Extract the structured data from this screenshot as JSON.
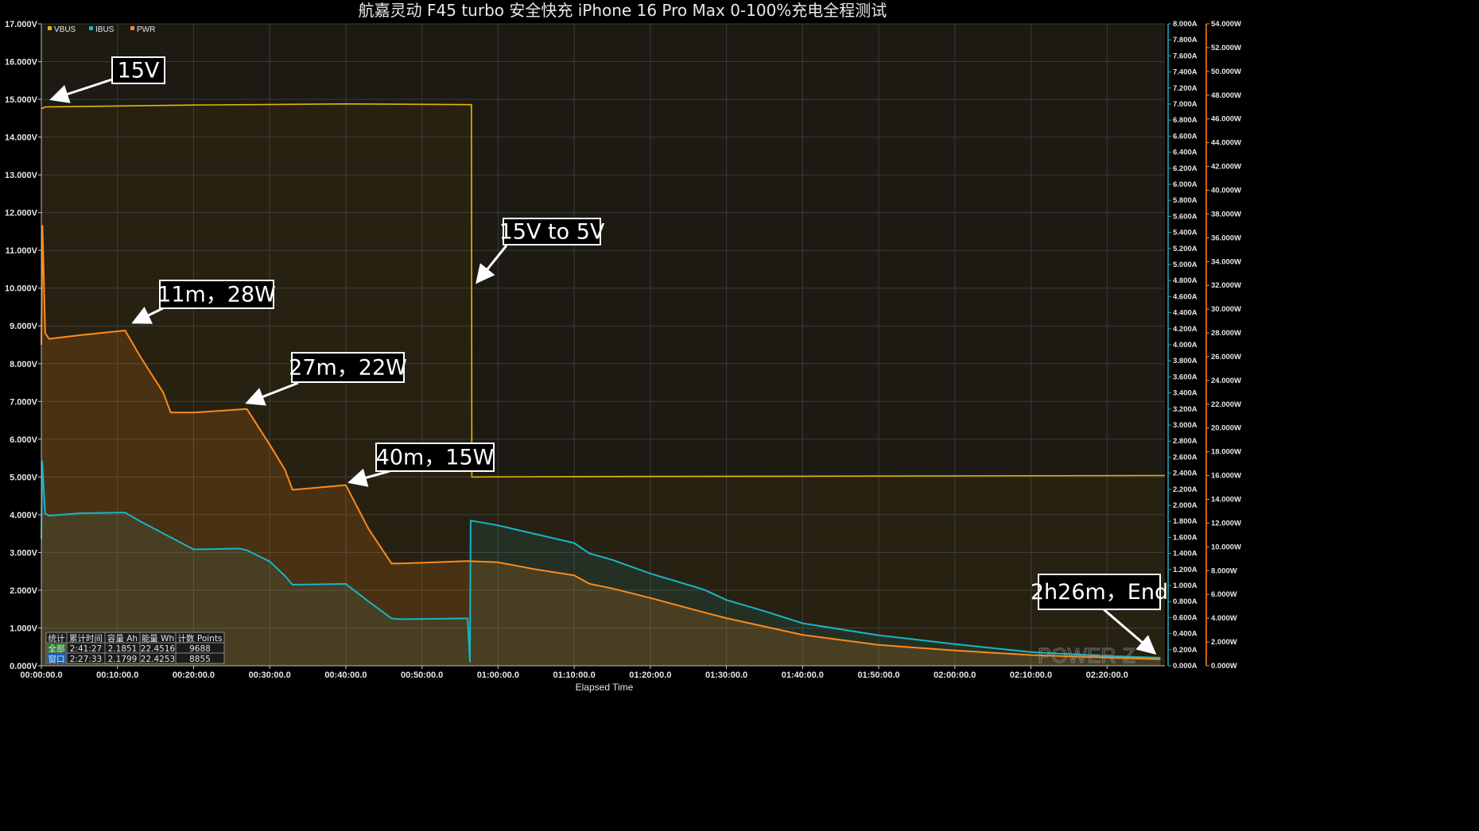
{
  "chart_data": {
    "type": "line",
    "title": "航嘉灵动 F45 turbo 安全快充  iPhone 16 Pro Max 0-100%充电全程测试",
    "xlabel": "Elapsed Time",
    "x_unit": "minutes",
    "xlim": [
      0,
      147.6
    ],
    "x_ticks": [
      "00:00:00.0",
      "00:10:00.0",
      "00:20:00.0",
      "00:30:00.0",
      "00:40:00.0",
      "00:50:00.0",
      "01:00:00.0",
      "01:10:00.0",
      "01:20:00.0",
      "01:30:00.0",
      "01:40:00.0",
      "01:50:00.0",
      "02:00:00.0",
      "02:10:00.0",
      "02:20:00.0"
    ],
    "y_left": {
      "lim": [
        0,
        17
      ],
      "ticks": [
        "0.000V",
        "1.000V",
        "2.000V",
        "3.000V",
        "4.000V",
        "5.000V",
        "6.000V",
        "7.000V",
        "8.000V",
        "9.000V",
        "10.000V",
        "11.000V",
        "12.000V",
        "13.000V",
        "14.000V",
        "15.000V",
        "16.000V",
        "17.000V"
      ]
    },
    "y_right1": {
      "lim": [
        0,
        8
      ],
      "ticks": [
        "0.000A",
        "0.200A",
        "0.400A",
        "0.600A",
        "0.800A",
        "1.000A",
        "1.200A",
        "1.400A",
        "1.600A",
        "1.800A",
        "2.000A",
        "2.200A",
        "2.400A",
        "2.600A",
        "2.800A",
        "3.000A",
        "3.200A",
        "3.400A",
        "3.600A",
        "3.800A",
        "4.000A",
        "4.200A",
        "4.400A",
        "4.600A",
        "4.800A",
        "5.000A",
        "5.200A",
        "5.400A",
        "5.600A",
        "5.800A",
        "6.000A",
        "6.200A",
        "6.400A",
        "6.600A",
        "6.800A",
        "7.000A",
        "7.200A",
        "7.400A",
        "7.600A",
        "7.800A",
        "8.000A"
      ]
    },
    "y_right2": {
      "lim": [
        0,
        54
      ],
      "ticks": [
        "0.000W",
        "2.000W",
        "4.000W",
        "6.000W",
        "8.000W",
        "10.000W",
        "12.000W",
        "14.000W",
        "16.000W",
        "18.000W",
        "20.000W",
        "22.000W",
        "24.000W",
        "26.000W",
        "28.000W",
        "30.000W",
        "32.000W",
        "34.000W",
        "36.000W",
        "38.000W",
        "40.000W",
        "42.000W",
        "44.000W",
        "46.000W",
        "48.000W",
        "50.000W",
        "52.000W",
        "54.000W"
      ]
    },
    "legend_position": "top-left",
    "grid": true,
    "series": [
      {
        "name": "VBUS",
        "axis": "left",
        "color": "#e6b800",
        "points": [
          [
            0,
            14.75
          ],
          [
            0.5,
            14.8
          ],
          [
            20,
            14.85
          ],
          [
            40,
            14.88
          ],
          [
            56.5,
            14.86
          ],
          [
            56.55,
            5.0
          ],
          [
            70,
            5.01
          ],
          [
            100,
            5.02
          ],
          [
            147.6,
            5.04
          ]
        ]
      },
      {
        "name": "IBUS",
        "axis": "right1",
        "color": "#17b6c7",
        "points": [
          [
            0,
            1.58
          ],
          [
            0.1,
            2.55
          ],
          [
            0.5,
            1.9
          ],
          [
            1,
            1.87
          ],
          [
            5,
            1.9
          ],
          [
            11,
            1.91
          ],
          [
            13,
            1.8
          ],
          [
            17,
            1.6
          ],
          [
            20,
            1.45
          ],
          [
            26,
            1.46
          ],
          [
            27,
            1.44
          ],
          [
            30,
            1.3
          ],
          [
            32,
            1.12
          ],
          [
            33,
            1.01
          ],
          [
            40,
            1.02
          ],
          [
            43,
            0.8
          ],
          [
            46,
            0.59
          ],
          [
            47,
            0.58
          ],
          [
            56,
            0.59
          ],
          [
            56.3,
            0.05
          ],
          [
            56.4,
            1.81
          ],
          [
            60,
            1.75
          ],
          [
            70,
            1.53
          ],
          [
            72,
            1.4
          ],
          [
            75,
            1.32
          ],
          [
            80,
            1.15
          ],
          [
            87,
            0.95
          ],
          [
            90,
            0.82
          ],
          [
            95,
            0.68
          ],
          [
            100,
            0.53
          ],
          [
            110,
            0.38
          ],
          [
            120,
            0.27
          ],
          [
            130,
            0.17
          ],
          [
            140,
            0.12
          ],
          [
            147,
            0.1
          ]
        ]
      },
      {
        "name": "PWR",
        "axis": "right2",
        "color": "#ff8a1a",
        "points": [
          [
            0,
            27.0
          ],
          [
            0.15,
            37.0
          ],
          [
            0.25,
            34.5
          ],
          [
            0.5,
            28.0
          ],
          [
            1,
            27.5
          ],
          [
            5,
            27.8
          ],
          [
            11,
            28.2
          ],
          [
            13,
            26.0
          ],
          [
            16,
            23.0
          ],
          [
            17,
            21.3
          ],
          [
            20,
            21.3
          ],
          [
            27,
            21.6
          ],
          [
            30,
            18.6
          ],
          [
            32,
            16.5
          ],
          [
            33,
            14.8
          ],
          [
            40,
            15.2
          ],
          [
            43,
            11.5
          ],
          [
            46,
            8.6
          ],
          [
            47,
            8.6
          ],
          [
            56,
            8.8
          ],
          [
            60,
            8.7
          ],
          [
            65,
            8.1
          ],
          [
            70,
            7.6
          ],
          [
            72,
            6.9
          ],
          [
            75,
            6.5
          ],
          [
            80,
            5.7
          ],
          [
            87,
            4.5
          ],
          [
            90,
            4.0
          ],
          [
            95,
            3.3
          ],
          [
            100,
            2.6
          ],
          [
            110,
            1.75
          ],
          [
            120,
            1.28
          ],
          [
            130,
            0.9
          ],
          [
            140,
            0.68
          ],
          [
            147,
            0.55
          ]
        ]
      }
    ],
    "annotations": [
      {
        "label": "15V"
      },
      {
        "label": "15V to 5V"
      },
      {
        "label": "11m，28W"
      },
      {
        "label": "27m，22W"
      },
      {
        "label": "40m，15W"
      },
      {
        "label": "2h26m，End"
      }
    ],
    "stats_table": {
      "headers": [
        "统计",
        "累计时间",
        "容量 Ah",
        "能量 Wh",
        "计数 Points"
      ],
      "rows": [
        [
          "全部",
          "2:41:27",
          "2.1851",
          "22.4516",
          "9688"
        ],
        [
          "窗口",
          "2:27:33",
          "2.1799",
          "22.4253",
          "8855"
        ]
      ]
    },
    "watermark": "POWER-Z"
  }
}
